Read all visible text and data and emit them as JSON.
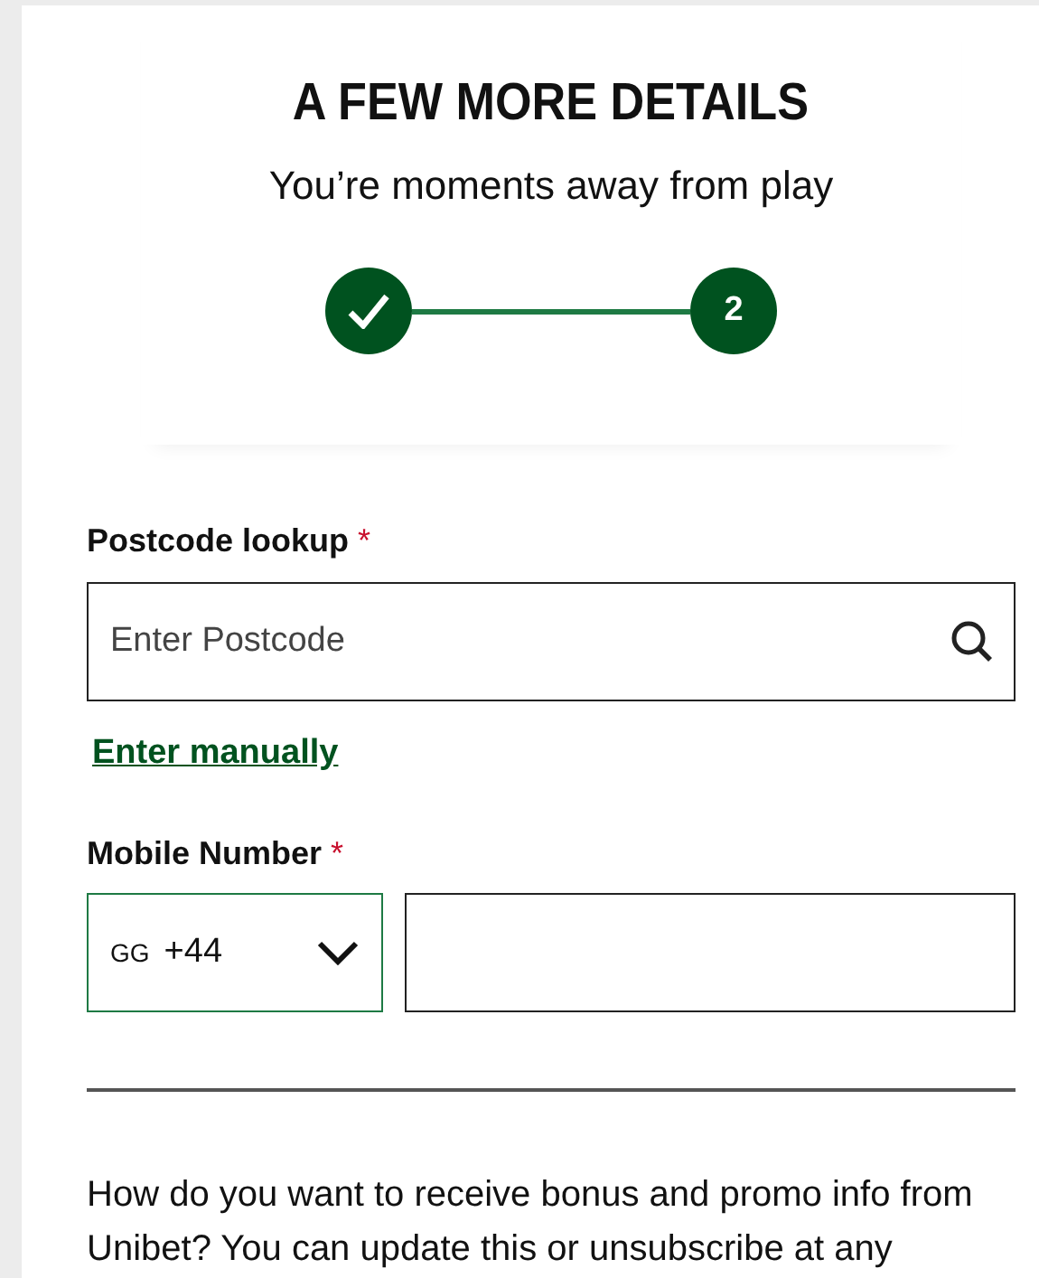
{
  "header": {
    "title": "A FEW MORE DETAILS",
    "subtitle": "You’re moments away from play"
  },
  "steps": [
    {
      "kind": "done"
    },
    {
      "kind": "current",
      "label": "2"
    }
  ],
  "postcode": {
    "label": "Postcode lookup",
    "required_mark": "*",
    "placeholder": "Enter Postcode"
  },
  "manual_link": "Enter manually",
  "mobile": {
    "label": "Mobile Number",
    "required_mark": "*",
    "country": "GG",
    "code": "+44",
    "focused": true
  },
  "consent_text": "How do you want to receive bonus and promo info from Unibet? You can update this or unsubscribe at any"
}
